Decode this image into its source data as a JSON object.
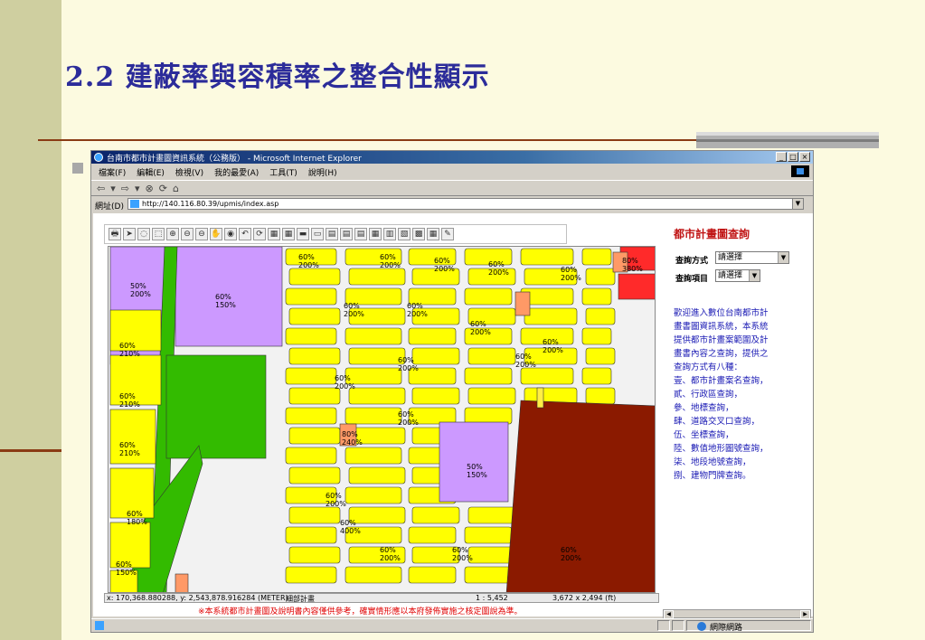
{
  "slide": {
    "title": "2.2 建蔽率與容積率之整合性顯示"
  },
  "window": {
    "title": "台南市都市計畫圖資訊系統（公務版） - Microsoft Internet Explorer",
    "controls": [
      "_",
      "□",
      "×"
    ],
    "menu": [
      "檔案(F)",
      "編輯(E)",
      "檢視(V)",
      "我的最愛(A)",
      "工具(T)",
      "說明(H)"
    ],
    "nav_glyphs": [
      "⇦",
      "▾",
      "⇨",
      "▾",
      "⊗",
      "⟳",
      "⌂"
    ],
    "address_label": "網址(D)",
    "url": "http://140.116.80.39/upmis/index.asp"
  },
  "gis_tools": [
    "🖶",
    "➤",
    "◌",
    "⬚",
    "⊕",
    "⊖",
    "⊖",
    "✋",
    "◉",
    "↶",
    "⟳",
    "▦",
    "▦",
    "▬",
    "▭",
    "▤",
    "▤",
    "▤",
    "▦",
    "▥",
    "▧",
    "▩",
    "▦",
    "✎"
  ],
  "map": {
    "zones": [
      {
        "type": "yellow",
        "bcr": "60%",
        "far": "200%"
      },
      {
        "type": "purple",
        "bcr": "50%",
        "far": "200%"
      },
      {
        "type": "purple",
        "bcr": "60%",
        "far": "150%"
      },
      {
        "type": "yellow",
        "bcr": "60%",
        "far": "210%"
      },
      {
        "type": "yellow",
        "bcr": "60%",
        "far": "180%"
      },
      {
        "type": "yellow",
        "bcr": "60%",
        "far": "150%"
      },
      {
        "type": "orange",
        "bcr": "80%",
        "far": "240%"
      },
      {
        "type": "orange",
        "bcr": "60%",
        "far": "400%"
      },
      {
        "type": "purple",
        "bcr": "50%",
        "far": "150%"
      },
      {
        "type": "red",
        "bcr": "80%",
        "far": "380%"
      }
    ]
  },
  "status_line": {
    "coords": "x: 170,368.880288, y: 2,543,878.916284 (METER)",
    "layer": "細部計畫",
    "scale": "1 : 5,452",
    "size": "3,672 x 2,494 (ft)"
  },
  "notice": "※本系統都市計畫圖及說明書內容僅供參考，確實情形應以本府發佈實施之核定圖說為準。",
  "panel": {
    "heading": "都市計畫圖查詢",
    "query_method_label": "查詢方式",
    "query_method_value": "請選擇",
    "query_item_label": "查詢項目",
    "query_item_value": "請選擇",
    "help_lines": [
      "歡迎進入數位台南都市計",
      "畫書圖資訊系統，本系統",
      "提供都市計畫案範圍及計",
      "畫書內容之查詢，提供之",
      "查詢方式有八種：",
      "壹、都市計畫案名查詢，",
      "貳、行政區查詢，",
      "參、地標查詢，",
      "肆、道路交叉口查詢，",
      "伍、坐標查詢，",
      "陸、數值地形圖號查詢，",
      "柒、地段地號查詢，",
      "捌、建物門牌查詢。"
    ]
  },
  "statusbar": {
    "zone": "網際網路"
  },
  "colors": {
    "residential": "#ffff00",
    "park": "#33bb00",
    "public": "#cc99ff",
    "industrial": "#8b1a00",
    "commercial": "#ff3333",
    "orange": "#ff9966",
    "road": "#ffffff"
  }
}
